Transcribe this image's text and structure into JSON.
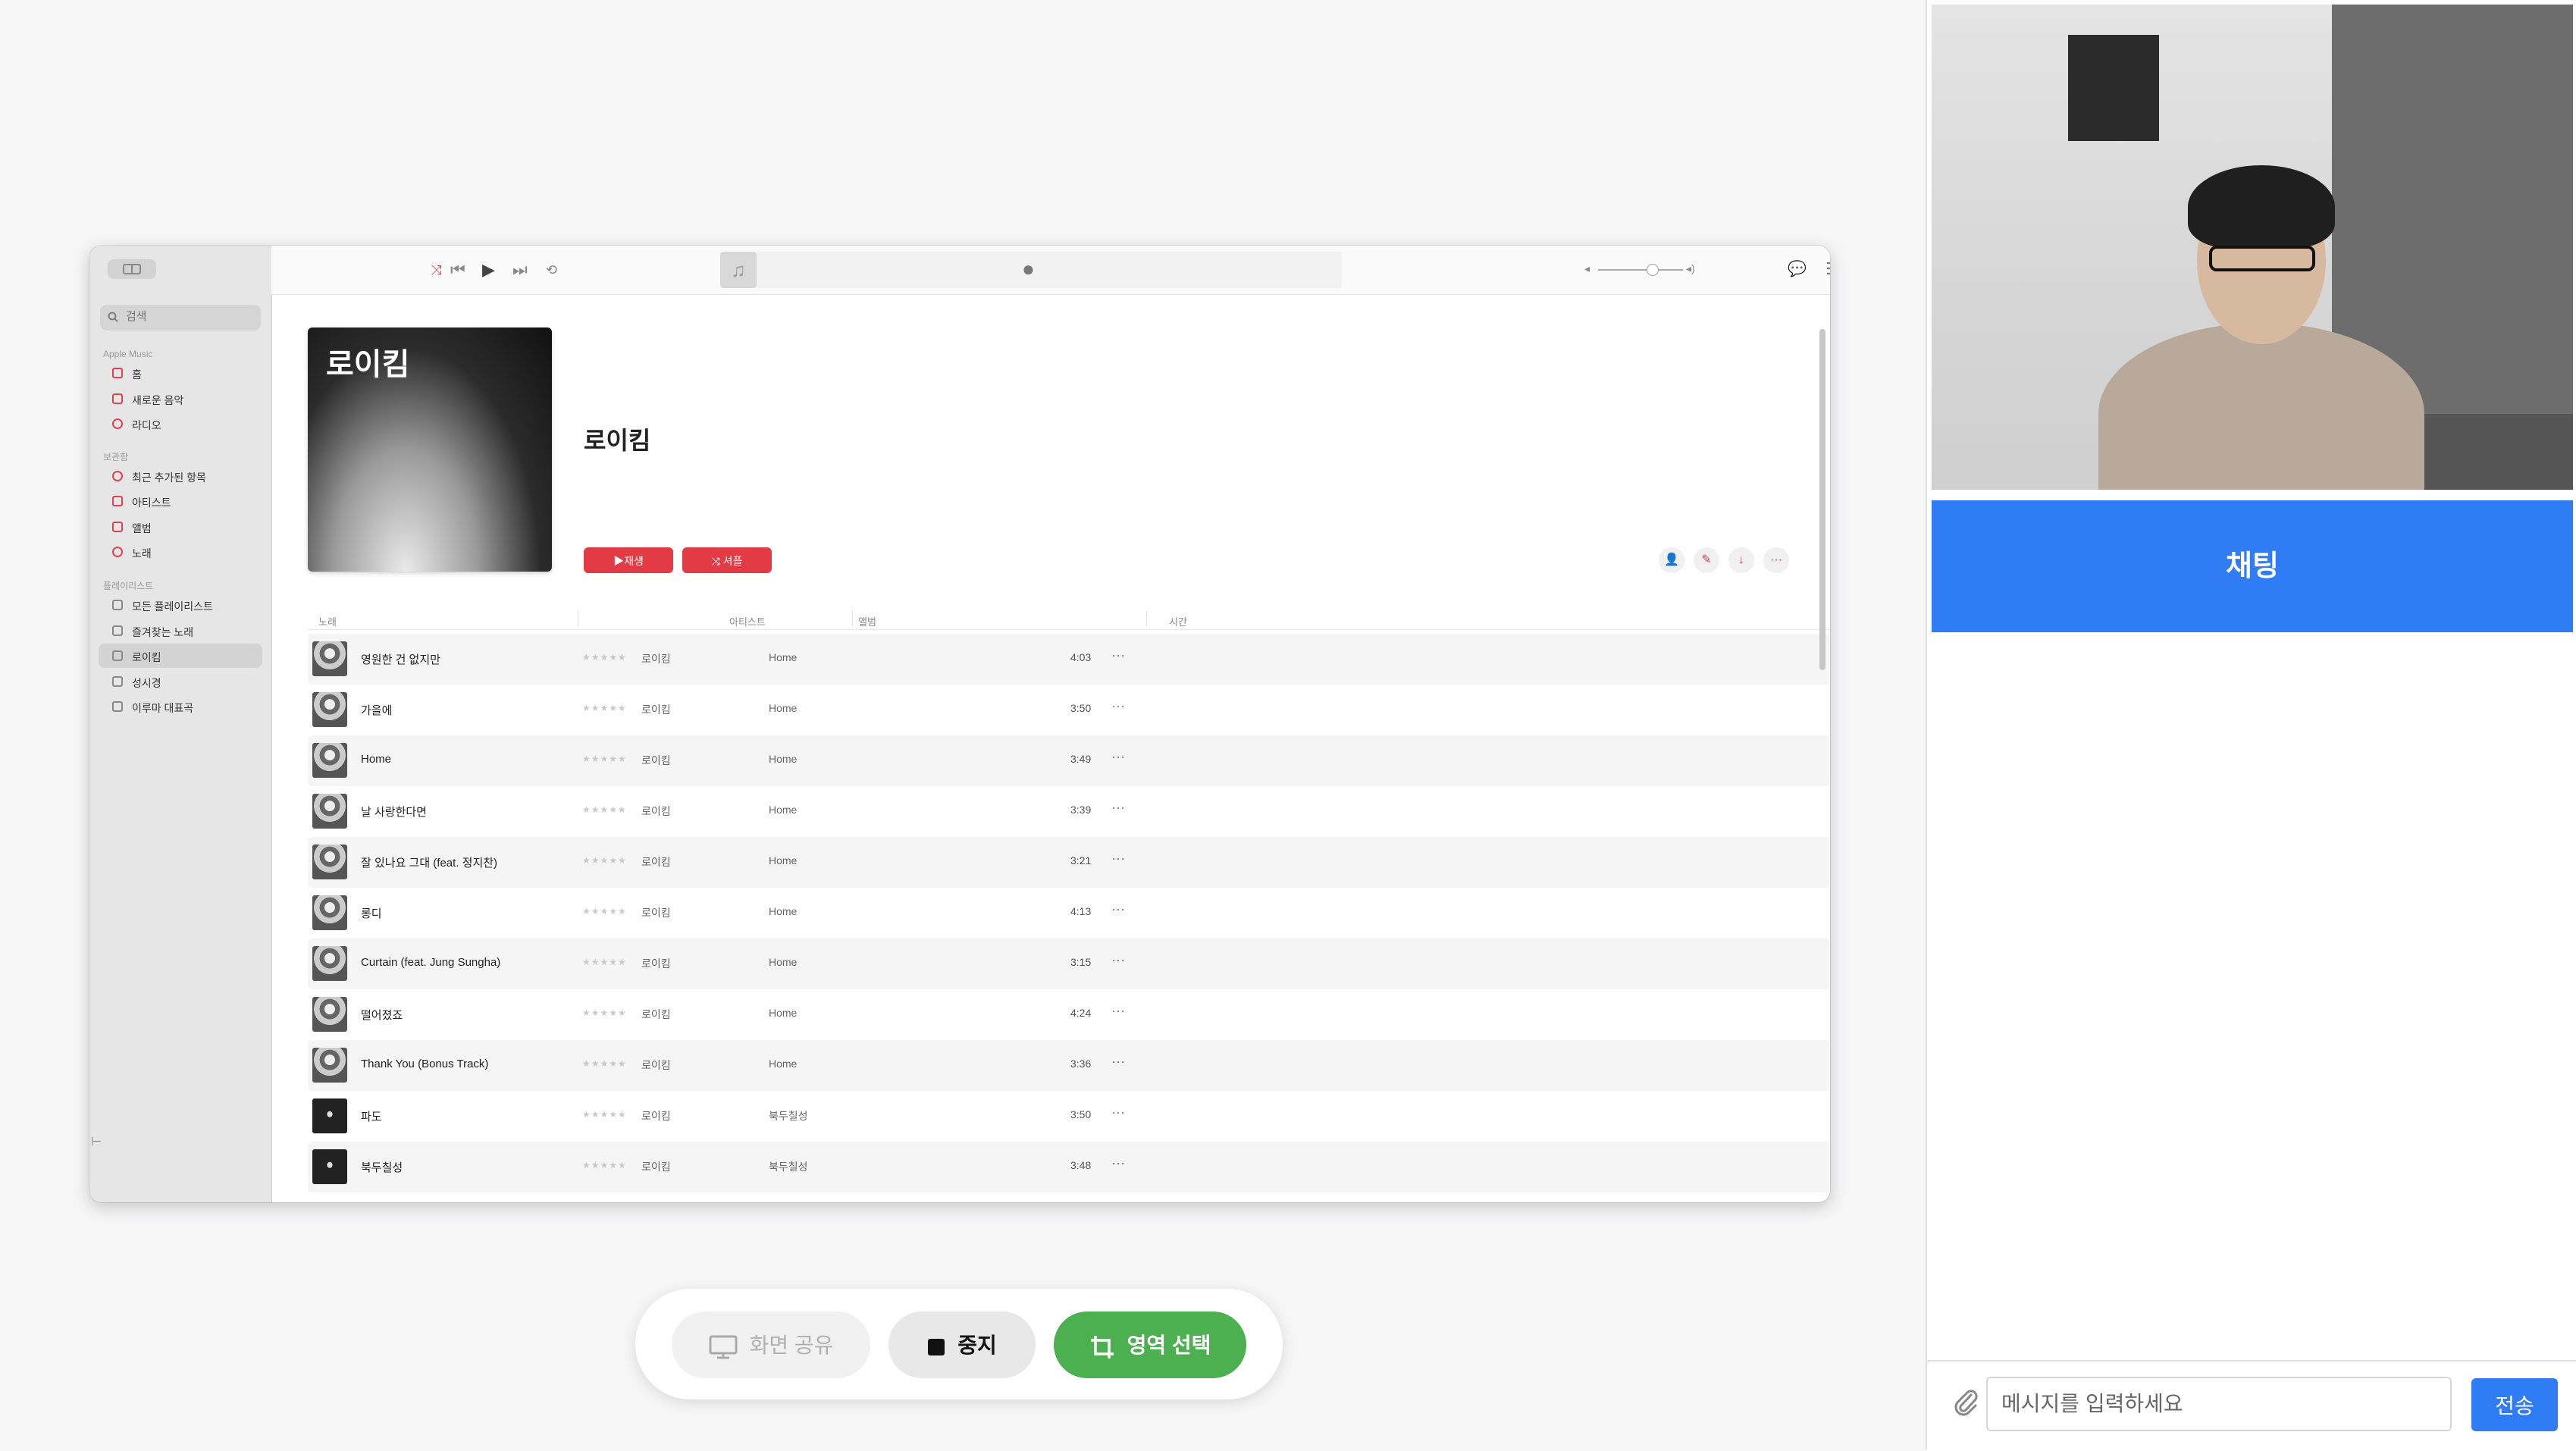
{
  "sidebar": {
    "search_placeholder": "검색",
    "sections": {
      "apple_music": "Apple Music",
      "library": "보관함",
      "playlists": "플레이리스트"
    },
    "apple_music_items": [
      {
        "label": "홈",
        "icon": "home-icon"
      },
      {
        "label": "새로운 음악",
        "icon": "grid-icon"
      },
      {
        "label": "라디오",
        "icon": "radio-icon"
      }
    ],
    "library_items": [
      {
        "label": "최근 추가된 항목",
        "icon": "clock-icon"
      },
      {
        "label": "아티스트",
        "icon": "microphone-icon"
      },
      {
        "label": "앨범",
        "icon": "album-icon"
      },
      {
        "label": "노래",
        "icon": "music-note-icon"
      }
    ],
    "playlist_items": [
      {
        "label": "모든 플레이리스트",
        "icon": "grid-icon"
      },
      {
        "label": "즐겨찾는 노래",
        "icon": "star-icon"
      },
      {
        "label": "로이킴",
        "icon": "playlist-icon",
        "active": true
      },
      {
        "label": "성시경",
        "icon": "playlist-icon"
      },
      {
        "label": "이루마 대표곡",
        "icon": "playlist-icon"
      }
    ]
  },
  "player": {
    "album_cover_title": "로이킴",
    "playlist_title": "로이킴",
    "play_label": "▶재생",
    "shuffle_label": "⤨ 셔플"
  },
  "columns": {
    "title": "노래",
    "artist": "아티스트",
    "album": "앨범",
    "time": "시간"
  },
  "tracks": [
    {
      "title": "영원한 건 없지만",
      "stars": "★★★★★",
      "artist": "로이킴",
      "album": "Home",
      "time": "4:03",
      "thumb": "light"
    },
    {
      "title": "가을에",
      "stars": "★★★★★",
      "artist": "로이킴",
      "album": "Home",
      "time": "3:50",
      "thumb": "light"
    },
    {
      "title": "Home",
      "stars": "★★★★★",
      "artist": "로이킴",
      "album": "Home",
      "time": "3:49",
      "thumb": "light"
    },
    {
      "title": "날 사랑한다면",
      "stars": "★★★★★",
      "artist": "로이킴",
      "album": "Home",
      "time": "3:39",
      "thumb": "light"
    },
    {
      "title": "잘 있나요 그대 (feat. 정지찬)",
      "stars": "★★★★★",
      "artist": "로이킴",
      "album": "Home",
      "time": "3:21",
      "thumb": "light"
    },
    {
      "title": "롱디",
      "stars": "★★★★★",
      "artist": "로이킴",
      "album": "Home",
      "time": "4:13",
      "thumb": "light"
    },
    {
      "title": "Curtain (feat. Jung Sungha)",
      "stars": "★★★★★",
      "artist": "로이킴",
      "album": "Home",
      "time": "3:15",
      "thumb": "light"
    },
    {
      "title": "떨어졌죠",
      "stars": "★★★★★",
      "artist": "로이킴",
      "album": "Home",
      "time": "4:24",
      "thumb": "light"
    },
    {
      "title": "Thank You (Bonus Track)",
      "stars": "★★★★★",
      "artist": "로이킴",
      "album": "Home",
      "time": "3:36",
      "thumb": "light"
    },
    {
      "title": "파도",
      "stars": "★★★★★",
      "artist": "로이킴",
      "album": "북두칠성",
      "time": "3:50",
      "thumb": "dark"
    },
    {
      "title": "북두칠성",
      "stars": "★★★★★",
      "artist": "로이킴",
      "album": "북두칠성",
      "time": "3:48",
      "thumb": "dark"
    }
  ],
  "controls": {
    "share_label": "화면 공유",
    "stop_label": "중지",
    "region_label": "영역 선택"
  },
  "chat": {
    "header": "채팅",
    "input_placeholder": "메시지를 입력하세요",
    "send_label": "전송"
  },
  "colors": {
    "accent_red": "#e23b45",
    "chat_blue": "#2f7cf5",
    "region_green": "#4caf50"
  }
}
